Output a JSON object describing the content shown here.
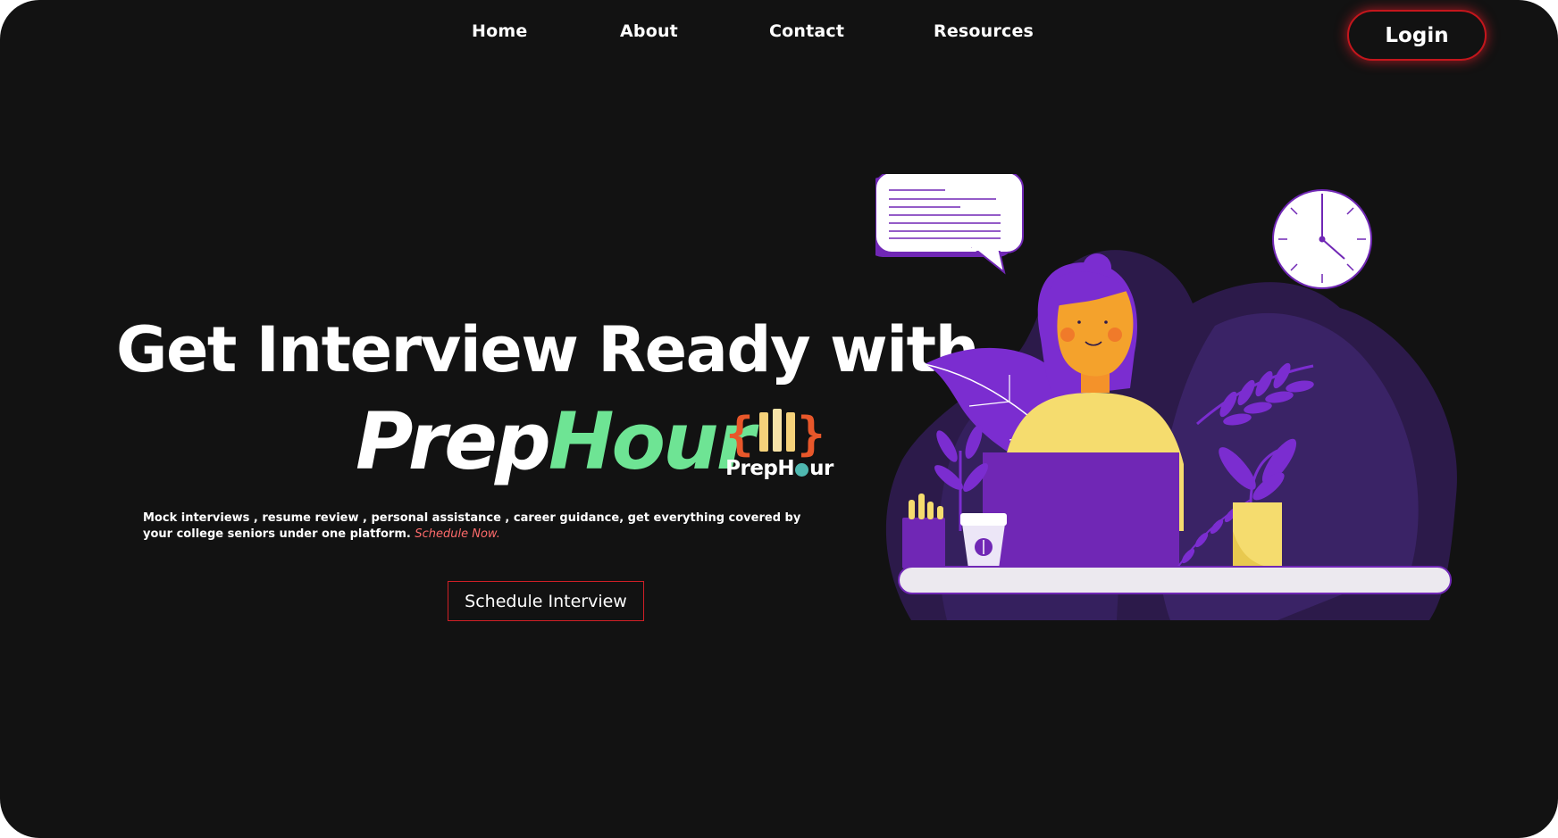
{
  "nav": {
    "items": [
      {
        "label": "Home"
      },
      {
        "label": "About"
      },
      {
        "label": "Contact"
      },
      {
        "label": "Resources"
      }
    ],
    "login_label": "Login"
  },
  "hero": {
    "title": "Get Interview Ready with",
    "brand_part1": "Prep",
    "brand_part2": "Hour",
    "description": "Mock interviews ,  resume review , personal assistance , career guidance, get everything covered by your college seniors under one platform. ",
    "description_link": "Schedule Now.",
    "cta_label": "Schedule Interview"
  },
  "logo": {
    "left_brace": "{",
    "right_brace": "}",
    "word_part1": "PrepH",
    "word_part2": "ur"
  },
  "colors": {
    "background": "#121212",
    "accent_green": "#6ee494",
    "accent_red": "#d01f26",
    "link_red": "#ff6b6b",
    "illustration_purple": "#7027b5"
  },
  "icons": [
    "speech-bubble-icon",
    "clock-icon",
    "laptop-icon",
    "leaf-icon",
    "coffee-cup-icon",
    "pen-holder-icon",
    "plant-pot-icon"
  ]
}
